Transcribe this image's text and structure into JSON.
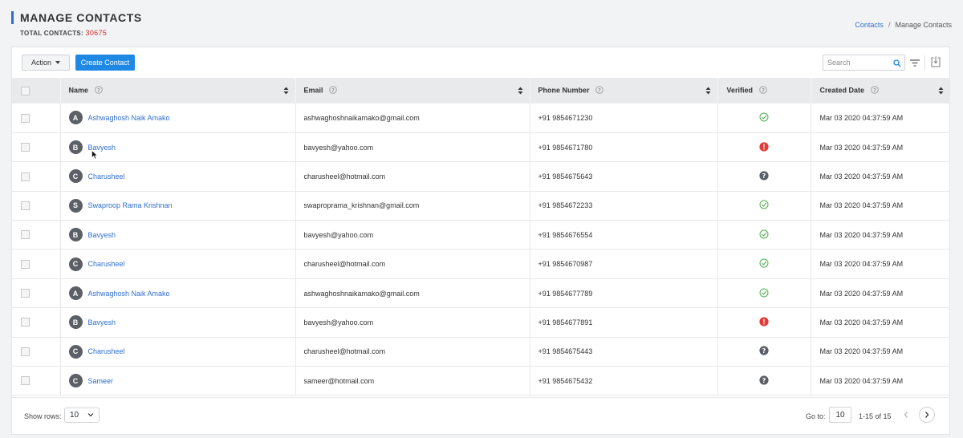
{
  "header": {
    "title": "MANAGE CONTACTS",
    "total_label": "TOTAL CONTACTS:",
    "total_count": "30675"
  },
  "breadcrumb": {
    "link": "Contacts",
    "separator": "/",
    "current": "Manage Contacts"
  },
  "toolbar": {
    "action_label": "Action",
    "create_label": "Create Contact",
    "search_placeholder": "Search",
    "search_value": ""
  },
  "table": {
    "columns": [
      "Name",
      "Email",
      "Phone Number",
      "Verified",
      "Created Date"
    ],
    "rows": [
      {
        "initial": "A",
        "name": "Ashwaghosh Naik Amako",
        "email": "ashwaghoshnaikamako@gmail.com",
        "phone": "+91 9854671230",
        "verified": "verified",
        "created": "Mar 03 2020 04:37:59 AM"
      },
      {
        "initial": "B",
        "name": "Bavyesh",
        "email": "bavyesh@yahoo.com",
        "phone": "+91 9854671780",
        "verified": "error",
        "created": "Mar 03 2020 04:37:59 AM"
      },
      {
        "initial": "C",
        "name": "Charusheel",
        "email": "charusheel@hotmail.com",
        "phone": "+91 9854675643",
        "verified": "unknown",
        "created": "Mar 03 2020 04:37:59 AM"
      },
      {
        "initial": "S",
        "name": "Swaproop Rama Krishnan",
        "email": "swaproprama_krishnan@gmail.com",
        "phone": "+91 9854672233",
        "verified": "verified",
        "created": "Mar 03 2020 04:37:59 AM"
      },
      {
        "initial": "B",
        "name": "Bavyesh",
        "email": "bavyesh@yahoo.com",
        "phone": "+91 9854676554",
        "verified": "verified",
        "created": "Mar 03 2020 04:37:59 AM"
      },
      {
        "initial": "C",
        "name": "Charusheel",
        "email": "charusheel@hotmail.com",
        "phone": "+91 9854670987",
        "verified": "verified",
        "created": "Mar 03 2020 04:37:59 AM"
      },
      {
        "initial": "A",
        "name": "Ashwaghosh Naik Amako",
        "email": "ashwaghoshnaikamako@gmail.com",
        "phone": "+91 9854677789",
        "verified": "verified",
        "created": "Mar 03 2020 04:37:59 AM"
      },
      {
        "initial": "B",
        "name": "Bavyesh",
        "email": "bavyesh@yahoo.com",
        "phone": "+91 9854677891",
        "verified": "error",
        "created": "Mar 03 2020 04:37:59 AM"
      },
      {
        "initial": "C",
        "name": "Charusheel",
        "email": "charusheel@hotmail.com",
        "phone": "+91 9854675443",
        "verified": "unknown",
        "created": "Mar 03 2020 04:37:59 AM"
      },
      {
        "initial": "C",
        "name": "Sameer",
        "email": "sameer@hotmail.com",
        "phone": "+91 9854675432",
        "verified": "unknown",
        "created": "Mar 03 2020 04:37:59 AM"
      }
    ]
  },
  "pagination": {
    "rows_label": "Show rows:",
    "rows_value": "10",
    "goto_label": "Go to:",
    "goto_value": "10",
    "range": "1-15 of 15"
  },
  "colors": {
    "accent": "#1e88e5",
    "link": "#2f6fd0",
    "verified": "#4caf50",
    "error": "#e53935",
    "unknown": "#5c6066",
    "count": "#d32f2f"
  },
  "icons": {
    "verified": "check-circle-icon",
    "error": "exclamation-circle-icon",
    "unknown": "question-circle-icon"
  }
}
